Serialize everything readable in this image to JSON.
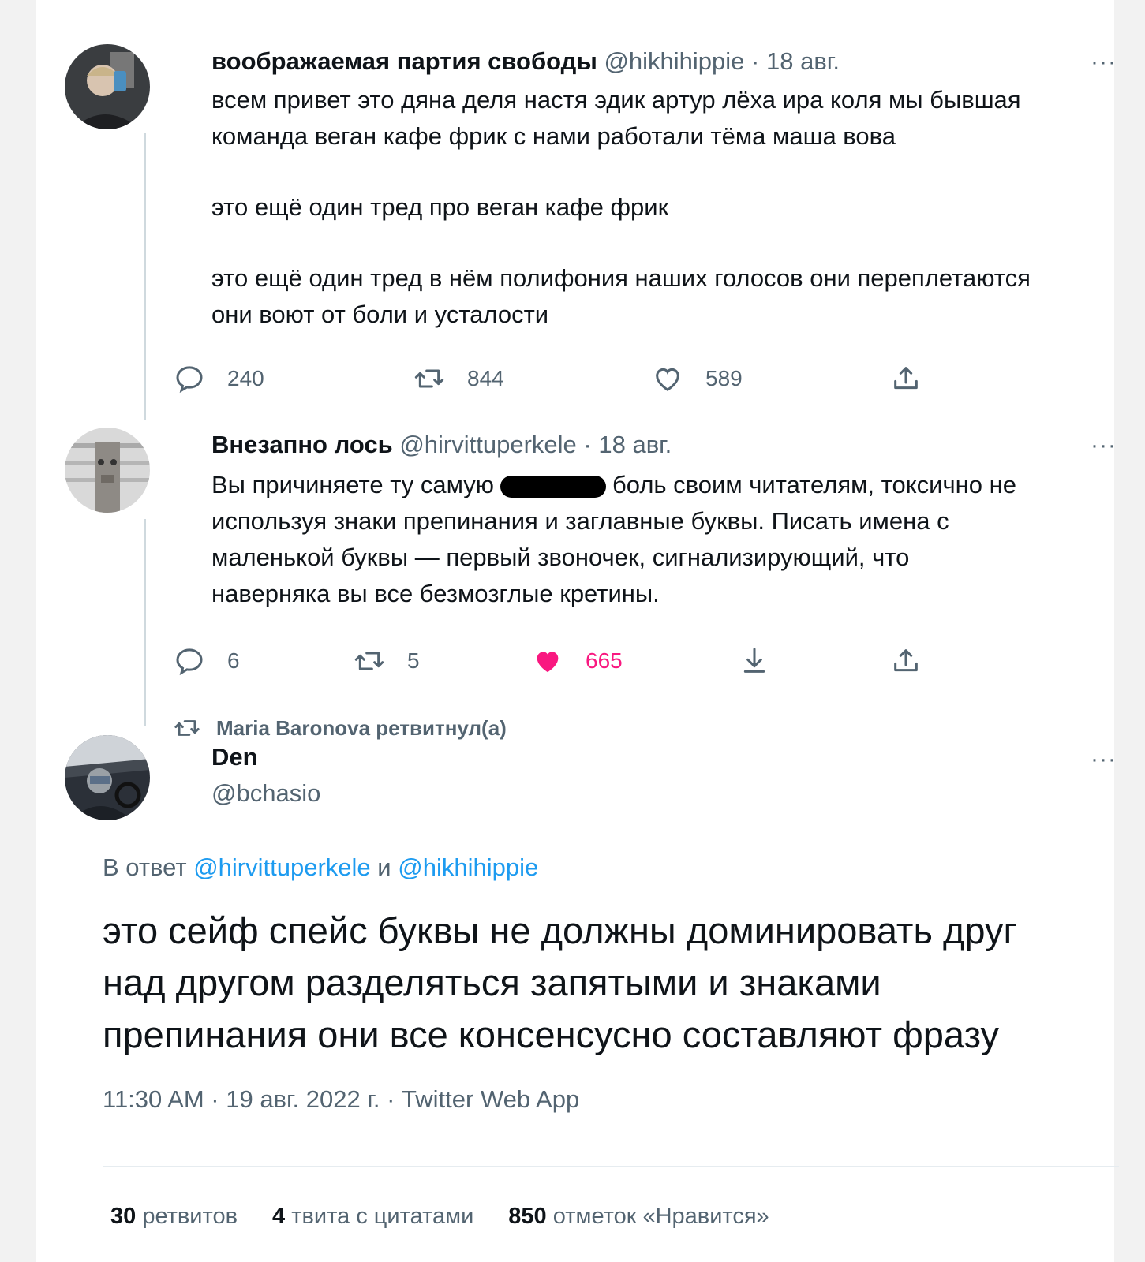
{
  "tweets": [
    {
      "name": "воображаемая партия свободы",
      "handle": "@hikhihippie",
      "dot": "·",
      "date": "18 авг.",
      "text_lines": [
        "всем привет это дяна деля настя эдик артур лёха ира коля мы бывшая",
        "команда веган кафе фрик с нами работали тёма маша вова",
        "это ещё один тред про веган кафе фрик",
        "это ещё один тред в нём полифония наших голосов они переплетаются",
        "они воют от боли и усталости"
      ],
      "replies": "240",
      "retweets": "844",
      "likes": "589"
    },
    {
      "name": "Внезапно лось",
      "handle": "@hirvittuperkele",
      "dot": "·",
      "date": "18 авг.",
      "text_line1_before": "Вы причиняете ту самую",
      "text_line1_after": "боль своим читателям, токсично не",
      "text_lines": [
        "используя знаки препинания и заглавные буквы. Писать имена с",
        "маленькой буквы — первый звоночек, сигнализирующий, что",
        "наверняка вы все безмозглые кретины."
      ],
      "replies": "6",
      "retweets": "5",
      "likes": "665"
    }
  ],
  "retweet_banner": "Maria Baronova ретвитнул(а)",
  "main": {
    "name": "Den",
    "handle": "@bchasio",
    "reply_to_prefix": "В ответ",
    "reply_to_user1": "@hirvittuperkele",
    "reply_to_and": "и",
    "reply_to_user2": "@hikhihippie",
    "text_lines": [
      "это сейф спейс буквы не должны доминировать друг",
      "над другом разделяться запятыми и знаками",
      "препинания они все консенсусно составляют фразу"
    ],
    "timestamp": "11:30 AM · 19 авг. 2022 г. · Twitter Web App",
    "stats": {
      "retweets_count": "30",
      "retweets_label": "ретвитов",
      "quotes_count": "4",
      "quotes_label": "твита с цитатами",
      "likes_count": "850",
      "likes_label": "отметок «Нравится»"
    }
  },
  "more_label": "···",
  "colors": {
    "like_active": "#f91880",
    "link": "#1d9bf0",
    "muted": "#536471"
  },
  "icons": [
    "reply-icon",
    "retweet-icon",
    "like-icon",
    "share-icon",
    "download-icon",
    "more-icon"
  ]
}
